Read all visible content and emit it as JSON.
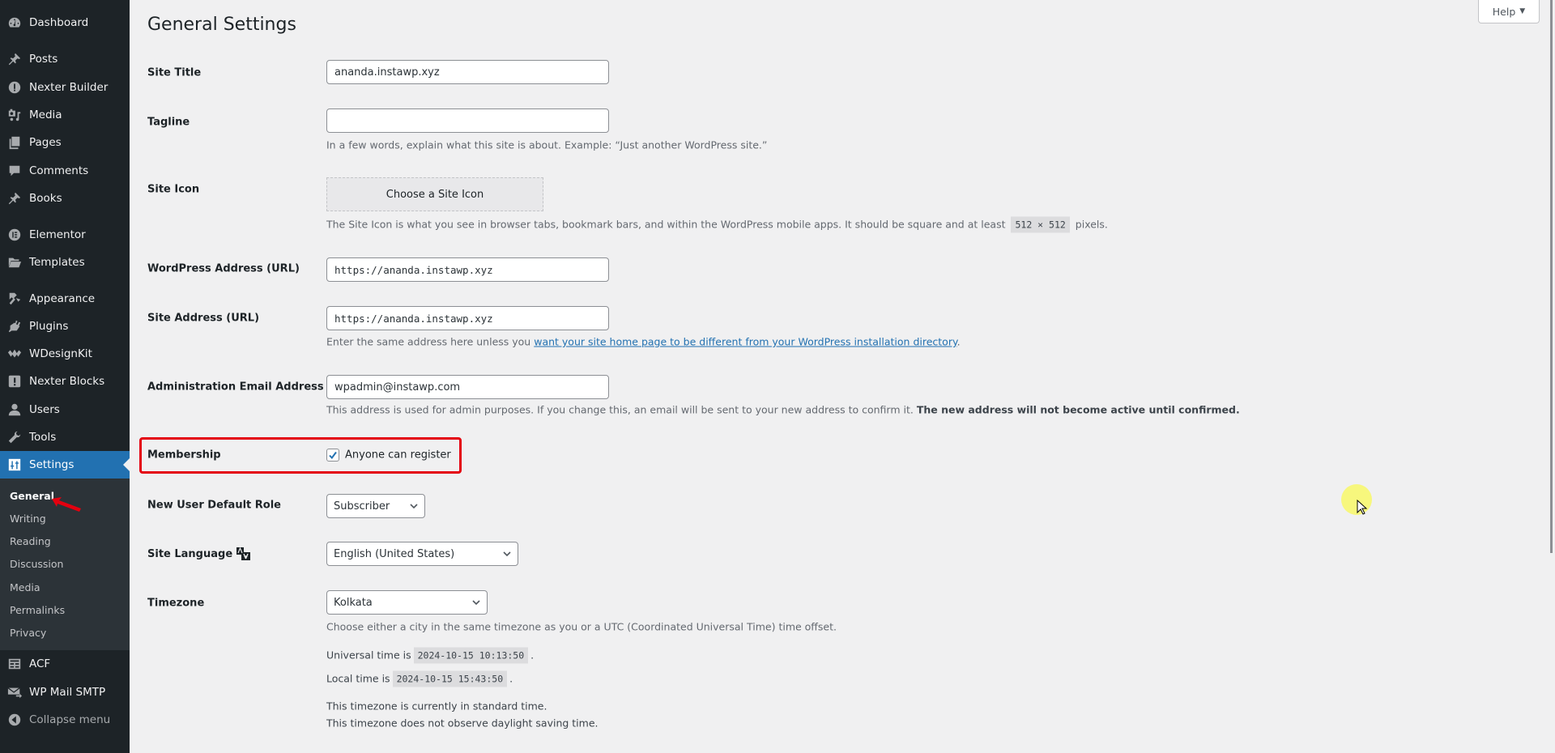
{
  "sidebar": {
    "items": [
      {
        "label": "Dashboard",
        "icon": "dashboard-icon"
      },
      {
        "label": "Posts",
        "icon": "pin-icon"
      },
      {
        "label": "Nexter Builder",
        "icon": "nexter-builder-icon"
      },
      {
        "label": "Media",
        "icon": "media-icon"
      },
      {
        "label": "Pages",
        "icon": "pages-icon"
      },
      {
        "label": "Comments",
        "icon": "comments-icon"
      },
      {
        "label": "Books",
        "icon": "pin-icon"
      },
      {
        "label": "Elementor",
        "icon": "elementor-icon"
      },
      {
        "label": "Templates",
        "icon": "folder-icon"
      },
      {
        "label": "Appearance",
        "icon": "paintbrush-icon"
      },
      {
        "label": "Plugins",
        "icon": "plug-icon"
      },
      {
        "label": "WDesignKit",
        "icon": "wdesignkit-icon"
      },
      {
        "label": "Nexter Blocks",
        "icon": "nexter-blocks-icon"
      },
      {
        "label": "Users",
        "icon": "users-icon"
      },
      {
        "label": "Tools",
        "icon": "wrench-icon"
      },
      {
        "label": "Settings",
        "icon": "settings-icon",
        "active": true
      }
    ],
    "submenu": [
      "General",
      "Writing",
      "Reading",
      "Discussion",
      "Media",
      "Permalinks",
      "Privacy"
    ],
    "submenu_current": "General",
    "bottom_items": [
      {
        "label": "ACF",
        "icon": "acf-icon"
      },
      {
        "label": "WP Mail SMTP",
        "icon": "mail-icon"
      }
    ],
    "collapse_label": "Collapse menu"
  },
  "header": {
    "title": "General Settings",
    "help_label": "Help"
  },
  "form": {
    "site_title": {
      "label": "Site Title",
      "value": "ananda.instawp.xyz"
    },
    "tagline": {
      "label": "Tagline",
      "value": "",
      "description": "In a few words, explain what this site is about. Example: “Just another WordPress site.”"
    },
    "site_icon": {
      "label": "Site Icon",
      "button": "Choose a Site Icon",
      "description_before": "The Site Icon is what you see in browser tabs, bookmark bars, and within the WordPress mobile apps. It should be square and at least",
      "size_code": "512 × 512",
      "description_after": "pixels."
    },
    "wp_address": {
      "label": "WordPress Address (URL)",
      "value": "https://ananda.instawp.xyz"
    },
    "site_address": {
      "label": "Site Address (URL)",
      "value": "https://ananda.instawp.xyz",
      "description_before": "Enter the same address here unless you",
      "link": "want your site home page to be different from your WordPress installation directory",
      "description_after": "."
    },
    "admin_email": {
      "label": "Administration Email Address",
      "value": "wpadmin@instawp.com",
      "description": "This address is used for admin purposes. If you change this, an email will be sent to your new address to confirm it.",
      "description_bold": "The new address will not become active until confirmed."
    },
    "membership": {
      "label": "Membership",
      "checkbox_label": "Anyone can register",
      "checked": true
    },
    "default_role": {
      "label": "New User Default Role",
      "value": "Subscriber"
    },
    "site_language": {
      "label": "Site Language",
      "value": "English (United States)"
    },
    "timezone": {
      "label": "Timezone",
      "value": "Kolkata",
      "description": "Choose either a city in the same timezone as you or a UTC (Coordinated Universal Time) time offset.",
      "universal_label": "Universal time is",
      "universal_time": "2024-10-15 10:13:50",
      "local_label": "Local time is",
      "local_time": "2024-10-15 15:43:50",
      "standard_note": "This timezone is currently in standard time.",
      "dst_note": "This timezone does not observe daylight saving time."
    }
  },
  "colors": {
    "sidebar_bg": "#1d2327",
    "accent": "#2271b1",
    "highlight_box": "#e4000f",
    "page_bg": "#f0f0f1"
  }
}
